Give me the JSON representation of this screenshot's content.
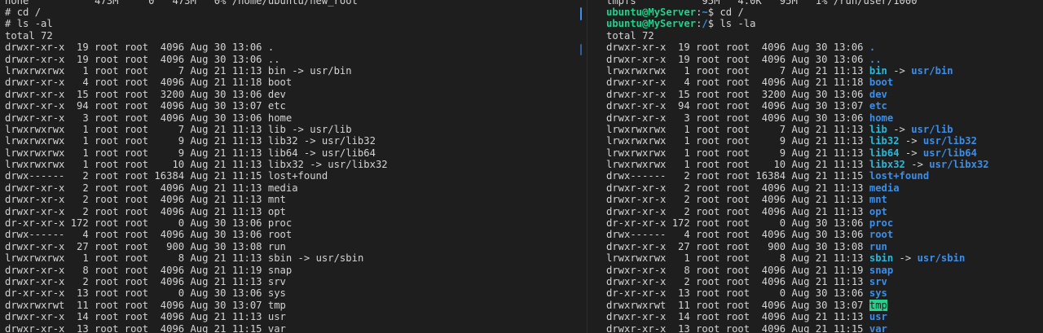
{
  "left_terminal": {
    "partial_top_line": "none           473M     0   473M   0% /home/ubuntu/new_root",
    "prompt_symbol": "#",
    "command_1": "cd /",
    "command_2": "ls -al",
    "total_line": "total 72",
    "entries": [
      {
        "perms": "drwxr-xr-x",
        "links": "19",
        "owner": "root",
        "group": "root",
        "size": "4096",
        "date": "Aug 30 13:06",
        "name": "."
      },
      {
        "perms": "drwxr-xr-x",
        "links": "19",
        "owner": "root",
        "group": "root",
        "size": "4096",
        "date": "Aug 30 13:06",
        "name": ".."
      },
      {
        "perms": "lrwxrwxrwx",
        "links": "1",
        "owner": "root",
        "group": "root",
        "size": "7",
        "date": "Aug 21 11:13",
        "name": "bin",
        "target": "usr/bin"
      },
      {
        "perms": "drwxr-xr-x",
        "links": "4",
        "owner": "root",
        "group": "root",
        "size": "4096",
        "date": "Aug 21 11:18",
        "name": "boot"
      },
      {
        "perms": "drwxr-xr-x",
        "links": "15",
        "owner": "root",
        "group": "root",
        "size": "3200",
        "date": "Aug 30 13:06",
        "name": "dev"
      },
      {
        "perms": "drwxr-xr-x",
        "links": "94",
        "owner": "root",
        "group": "root",
        "size": "4096",
        "date": "Aug 30 13:07",
        "name": "etc"
      },
      {
        "perms": "drwxr-xr-x",
        "links": "3",
        "owner": "root",
        "group": "root",
        "size": "4096",
        "date": "Aug 30 13:06",
        "name": "home"
      },
      {
        "perms": "lrwxrwxrwx",
        "links": "1",
        "owner": "root",
        "group": "root",
        "size": "7",
        "date": "Aug 21 11:13",
        "name": "lib",
        "target": "usr/lib"
      },
      {
        "perms": "lrwxrwxrwx",
        "links": "1",
        "owner": "root",
        "group": "root",
        "size": "9",
        "date": "Aug 21 11:13",
        "name": "lib32",
        "target": "usr/lib32"
      },
      {
        "perms": "lrwxrwxrwx",
        "links": "1",
        "owner": "root",
        "group": "root",
        "size": "9",
        "date": "Aug 21 11:13",
        "name": "lib64",
        "target": "usr/lib64"
      },
      {
        "perms": "lrwxrwxrwx",
        "links": "1",
        "owner": "root",
        "group": "root",
        "size": "10",
        "date": "Aug 21 11:13",
        "name": "libx32",
        "target": "usr/libx32"
      },
      {
        "perms": "drwx------",
        "links": "2",
        "owner": "root",
        "group": "root",
        "size": "16384",
        "date": "Aug 21 11:15",
        "name": "lost+found"
      },
      {
        "perms": "drwxr-xr-x",
        "links": "2",
        "owner": "root",
        "group": "root",
        "size": "4096",
        "date": "Aug 21 11:13",
        "name": "media"
      },
      {
        "perms": "drwxr-xr-x",
        "links": "2",
        "owner": "root",
        "group": "root",
        "size": "4096",
        "date": "Aug 21 11:13",
        "name": "mnt"
      },
      {
        "perms": "drwxr-xr-x",
        "links": "2",
        "owner": "root",
        "group": "root",
        "size": "4096",
        "date": "Aug 21 11:13",
        "name": "opt"
      },
      {
        "perms": "dr-xr-xr-x",
        "links": "172",
        "owner": "root",
        "group": "root",
        "size": "0",
        "date": "Aug 30 13:06",
        "name": "proc"
      },
      {
        "perms": "drwx------",
        "links": "4",
        "owner": "root",
        "group": "root",
        "size": "4096",
        "date": "Aug 30 13:06",
        "name": "root"
      },
      {
        "perms": "drwxr-xr-x",
        "links": "27",
        "owner": "root",
        "group": "root",
        "size": "900",
        "date": "Aug 30 13:08",
        "name": "run"
      },
      {
        "perms": "lrwxrwxrwx",
        "links": "1",
        "owner": "root",
        "group": "root",
        "size": "8",
        "date": "Aug 21 11:13",
        "name": "sbin",
        "target": "usr/sbin"
      },
      {
        "perms": "drwxr-xr-x",
        "links": "8",
        "owner": "root",
        "group": "root",
        "size": "4096",
        "date": "Aug 21 11:19",
        "name": "snap"
      },
      {
        "perms": "drwxr-xr-x",
        "links": "2",
        "owner": "root",
        "group": "root",
        "size": "4096",
        "date": "Aug 21 11:13",
        "name": "srv"
      },
      {
        "perms": "dr-xr-xr-x",
        "links": "13",
        "owner": "root",
        "group": "root",
        "size": "0",
        "date": "Aug 30 13:06",
        "name": "sys"
      },
      {
        "perms": "drwxrwxrwt",
        "links": "11",
        "owner": "root",
        "group": "root",
        "size": "4096",
        "date": "Aug 30 13:07",
        "name": "tmp"
      },
      {
        "perms": "drwxr-xr-x",
        "links": "14",
        "owner": "root",
        "group": "root",
        "size": "4096",
        "date": "Aug 21 11:13",
        "name": "usr"
      },
      {
        "perms": "drwxr-xr-x",
        "links": "13",
        "owner": "root",
        "group": "root",
        "size": "4096",
        "date": "Aug 21 11:15",
        "name": "var"
      }
    ]
  },
  "right_terminal": {
    "partial_top_line": "tmpfs           95M   4.0K   95M   1% /run/user/1000",
    "prompt_user_host": "ubuntu@MyServer",
    "prompt_path_1": "~",
    "prompt_path_2": "/",
    "prompt_symbol": "$",
    "command_1": "cd /",
    "command_2": "ls -la",
    "total_line": "total 72",
    "entries": [
      {
        "perms": "drwxr-xr-x",
        "links": "19",
        "owner": "root",
        "group": "root",
        "size": "4096",
        "date": "Aug 30 13:06",
        "name": "."
      },
      {
        "perms": "drwxr-xr-x",
        "links": "19",
        "owner": "root",
        "group": "root",
        "size": "4096",
        "date": "Aug 30 13:06",
        "name": ".."
      },
      {
        "perms": "lrwxrwxrwx",
        "links": "1",
        "owner": "root",
        "group": "root",
        "size": "7",
        "date": "Aug 21 11:13",
        "name": "bin",
        "target": "usr/bin"
      },
      {
        "perms": "drwxr-xr-x",
        "links": "4",
        "owner": "root",
        "group": "root",
        "size": "4096",
        "date": "Aug 21 11:18",
        "name": "boot"
      },
      {
        "perms": "drwxr-xr-x",
        "links": "15",
        "owner": "root",
        "group": "root",
        "size": "3200",
        "date": "Aug 30 13:06",
        "name": "dev"
      },
      {
        "perms": "drwxr-xr-x",
        "links": "94",
        "owner": "root",
        "group": "root",
        "size": "4096",
        "date": "Aug 30 13:07",
        "name": "etc"
      },
      {
        "perms": "drwxr-xr-x",
        "links": "3",
        "owner": "root",
        "group": "root",
        "size": "4096",
        "date": "Aug 30 13:06",
        "name": "home"
      },
      {
        "perms": "lrwxrwxrwx",
        "links": "1",
        "owner": "root",
        "group": "root",
        "size": "7",
        "date": "Aug 21 11:13",
        "name": "lib",
        "target": "usr/lib"
      },
      {
        "perms": "lrwxrwxrwx",
        "links": "1",
        "owner": "root",
        "group": "root",
        "size": "9",
        "date": "Aug 21 11:13",
        "name": "lib32",
        "target": "usr/lib32"
      },
      {
        "perms": "lrwxrwxrwx",
        "links": "1",
        "owner": "root",
        "group": "root",
        "size": "9",
        "date": "Aug 21 11:13",
        "name": "lib64",
        "target": "usr/lib64"
      },
      {
        "perms": "lrwxrwxrwx",
        "links": "1",
        "owner": "root",
        "group": "root",
        "size": "10",
        "date": "Aug 21 11:13",
        "name": "libx32",
        "target": "usr/libx32"
      },
      {
        "perms": "drwx------",
        "links": "2",
        "owner": "root",
        "group": "root",
        "size": "16384",
        "date": "Aug 21 11:15",
        "name": "lost+found"
      },
      {
        "perms": "drwxr-xr-x",
        "links": "2",
        "owner": "root",
        "group": "root",
        "size": "4096",
        "date": "Aug 21 11:13",
        "name": "media"
      },
      {
        "perms": "drwxr-xr-x",
        "links": "2",
        "owner": "root",
        "group": "root",
        "size": "4096",
        "date": "Aug 21 11:13",
        "name": "mnt"
      },
      {
        "perms": "drwxr-xr-x",
        "links": "2",
        "owner": "root",
        "group": "root",
        "size": "4096",
        "date": "Aug 21 11:13",
        "name": "opt"
      },
      {
        "perms": "dr-xr-xr-x",
        "links": "172",
        "owner": "root",
        "group": "root",
        "size": "0",
        "date": "Aug 30 13:06",
        "name": "proc"
      },
      {
        "perms": "drwx------",
        "links": "4",
        "owner": "root",
        "group": "root",
        "size": "4096",
        "date": "Aug 30 13:06",
        "name": "root"
      },
      {
        "perms": "drwxr-xr-x",
        "links": "27",
        "owner": "root",
        "group": "root",
        "size": "900",
        "date": "Aug 30 13:08",
        "name": "run"
      },
      {
        "perms": "lrwxrwxrwx",
        "links": "1",
        "owner": "root",
        "group": "root",
        "size": "8",
        "date": "Aug 21 11:13",
        "name": "sbin",
        "target": "usr/sbin"
      },
      {
        "perms": "drwxr-xr-x",
        "links": "8",
        "owner": "root",
        "group": "root",
        "size": "4096",
        "date": "Aug 21 11:19",
        "name": "snap"
      },
      {
        "perms": "drwxr-xr-x",
        "links": "2",
        "owner": "root",
        "group": "root",
        "size": "4096",
        "date": "Aug 21 11:13",
        "name": "srv"
      },
      {
        "perms": "dr-xr-xr-x",
        "links": "13",
        "owner": "root",
        "group": "root",
        "size": "0",
        "date": "Aug 30 13:06",
        "name": "sys"
      },
      {
        "perms": "drwxrwxrwt",
        "links": "11",
        "owner": "root",
        "group": "root",
        "size": "4096",
        "date": "Aug 30 13:07",
        "name": "tmp",
        "sticky": true
      },
      {
        "perms": "drwxr-xr-x",
        "links": "14",
        "owner": "root",
        "group": "root",
        "size": "4096",
        "date": "Aug 21 11:13",
        "name": "usr"
      },
      {
        "perms": "drwxr-xr-x",
        "links": "13",
        "owner": "root",
        "group": "root",
        "size": "4096",
        "date": "Aug 21 11:15",
        "name": "var"
      }
    ]
  },
  "colors": {
    "background": "#1e1e1e",
    "foreground": "#d4d4d4",
    "prompt_green": "#23d18b",
    "directory_blue": "#3b8eea",
    "symlink_cyan": "#29b8db",
    "sticky_bg": "#23d18b"
  }
}
